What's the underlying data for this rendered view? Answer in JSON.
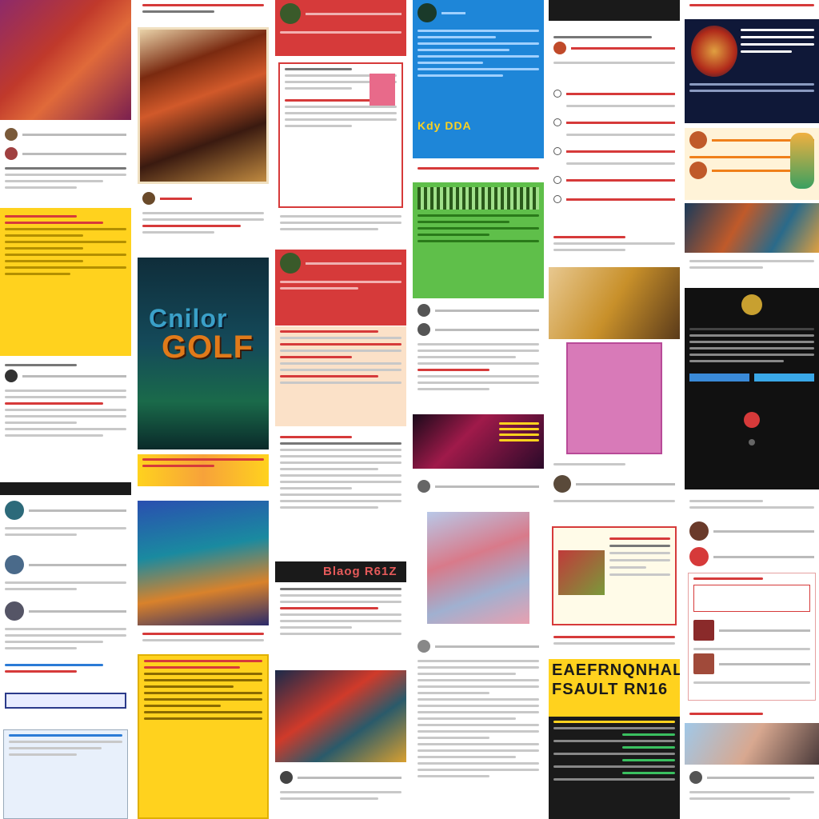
{
  "tiles": {
    "c2_poster_title": "Cnilor GOLF",
    "c3_banner_title": "Blaog R61Z",
    "c4_blue_title": "Kdy DDA",
    "c5_yellow_title_1": "EAEFRNQNHAL",
    "c5_yellow_title_2": "FSAULT RN16"
  },
  "colors": {
    "red": "#d63a3a",
    "yellow": "#ffd21e",
    "blue": "#1e86d8",
    "green": "#5fbf4a",
    "navy": "#0f1838",
    "black": "#1a1a1a"
  }
}
